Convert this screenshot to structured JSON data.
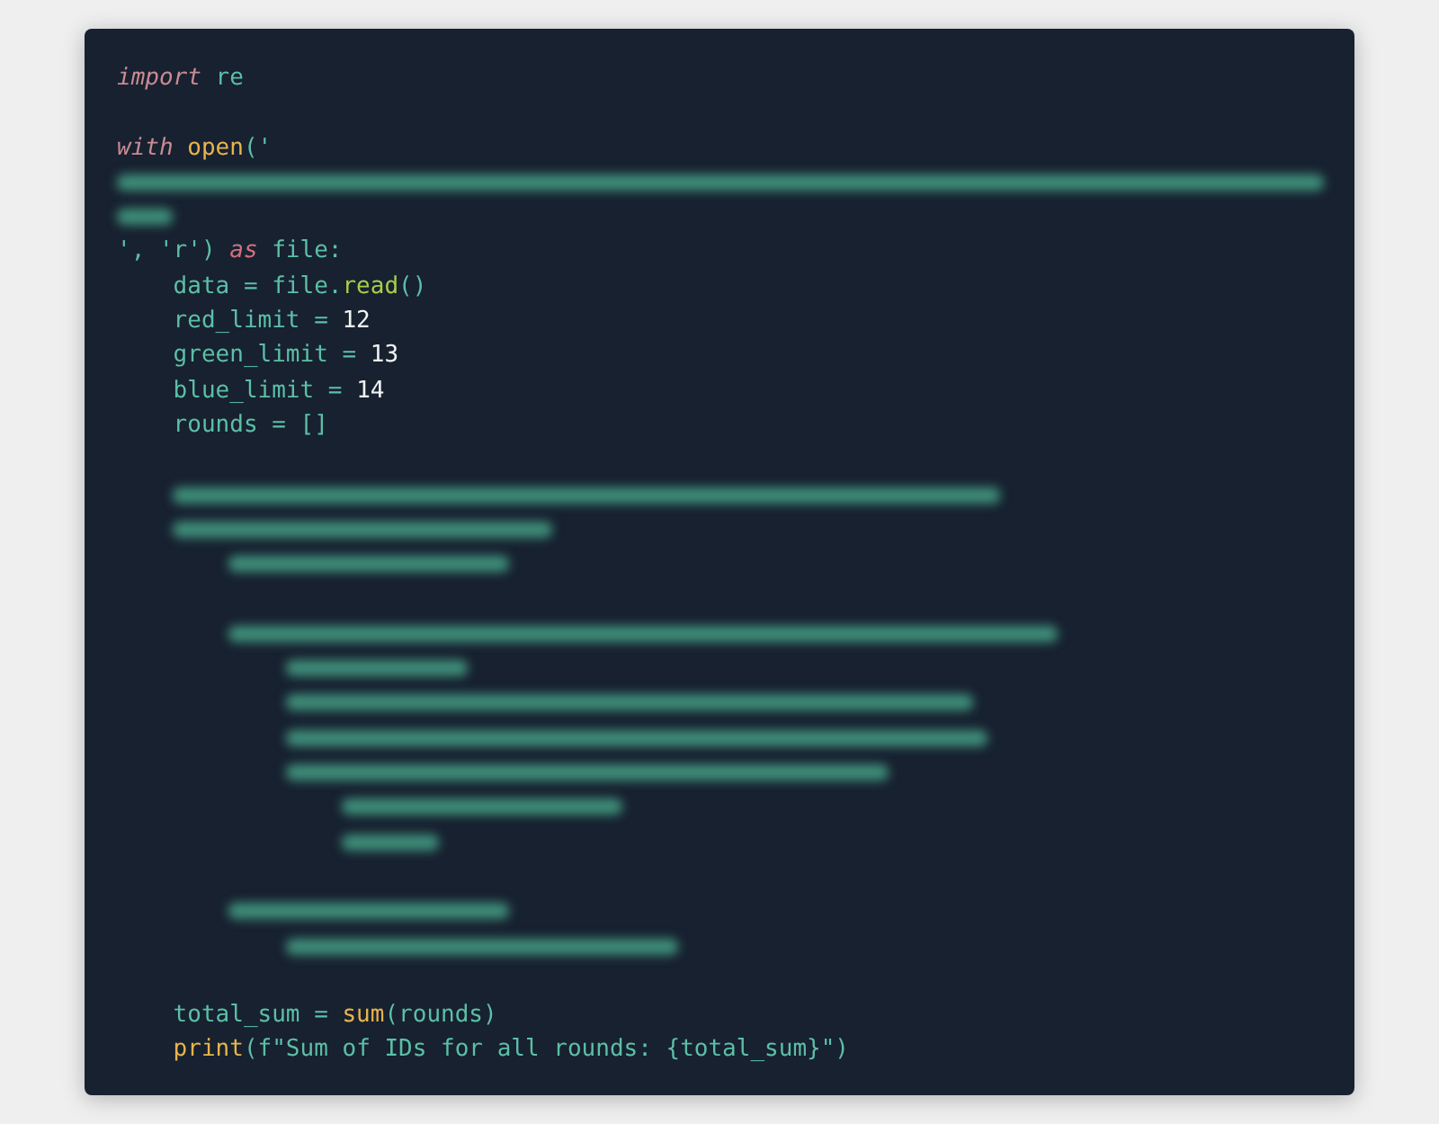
{
  "code_lines": [
    {
      "kind": "code",
      "tokens": [
        {
          "t": "import",
          "kind": "kw"
        },
        {
          "t": " re",
          "kind": "id"
        }
      ]
    },
    {
      "kind": "blank"
    },
    {
      "kind": "code",
      "tokens": [
        {
          "t": "with",
          "kind": "kw"
        },
        {
          "t": " open",
          "kind": "fn"
        },
        {
          "t": "('",
          "kind": "id"
        }
      ]
    },
    {
      "kind": "redacted"
    },
    {
      "kind": "redacted"
    },
    {
      "kind": "code",
      "tokens": [
        {
          "t": "', 'r') ",
          "kind": "id"
        },
        {
          "t": "as",
          "kind": "kw2"
        },
        {
          "t": " file:",
          "kind": "id"
        }
      ]
    },
    {
      "kind": "code",
      "tokens": [
        {
          "t": "    data = file.",
          "kind": "id"
        },
        {
          "t": "read",
          "kind": "method"
        },
        {
          "t": "()",
          "kind": "id"
        }
      ]
    },
    {
      "kind": "code",
      "tokens": [
        {
          "t": "    red_limit = ",
          "kind": "id"
        },
        {
          "t": "12",
          "kind": "num"
        }
      ]
    },
    {
      "kind": "code",
      "tokens": [
        {
          "t": "    green_limit = ",
          "kind": "id"
        },
        {
          "t": "13",
          "kind": "num"
        }
      ]
    },
    {
      "kind": "code",
      "tokens": [
        {
          "t": "    blue_limit = ",
          "kind": "id"
        },
        {
          "t": "14",
          "kind": "num"
        }
      ]
    },
    {
      "kind": "code",
      "tokens": [
        {
          "t": "    rounds = []",
          "kind": "id"
        }
      ]
    },
    {
      "kind": "blank"
    },
    {
      "kind": "redacted"
    },
    {
      "kind": "redacted"
    },
    {
      "kind": "redacted"
    },
    {
      "kind": "blank"
    },
    {
      "kind": "redacted"
    },
    {
      "kind": "redacted"
    },
    {
      "kind": "redacted"
    },
    {
      "kind": "redacted"
    },
    {
      "kind": "redacted"
    },
    {
      "kind": "redacted"
    },
    {
      "kind": "redacted"
    },
    {
      "kind": "blank"
    },
    {
      "kind": "redacted"
    },
    {
      "kind": "redacted"
    },
    {
      "kind": "blank"
    },
    {
      "kind": "code",
      "tokens": [
        {
          "t": "    total_sum = ",
          "kind": "id"
        },
        {
          "t": "sum",
          "kind": "fn"
        },
        {
          "t": "(rounds)",
          "kind": "id"
        }
      ]
    },
    {
      "kind": "code",
      "tokens": [
        {
          "t": "    print",
          "kind": "fn"
        },
        {
          "t": "(f\"Sum of IDs for all rounds: {total_sum}\")",
          "kind": "id"
        }
      ]
    }
  ]
}
